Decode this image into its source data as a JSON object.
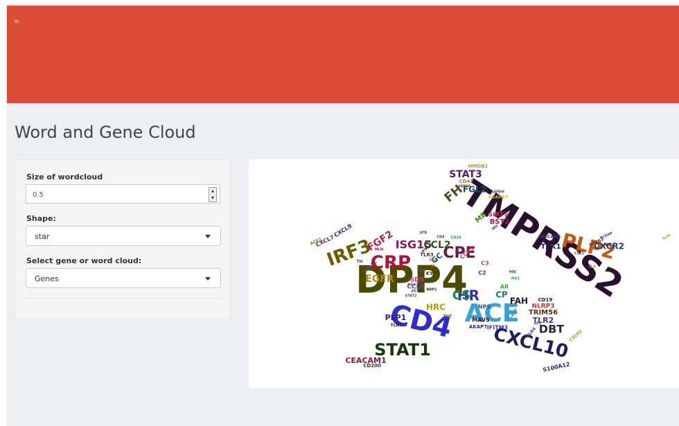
{
  "header": {
    "menu_icon": "hamburger-icon",
    "menu_glyph": "≡",
    "color": "#dd4b39"
  },
  "page": {
    "title": "Word and Gene Cloud",
    "background": "#ecf0f5"
  },
  "sidebar": {
    "size": {
      "label": "Size of wordcloud",
      "value": "0.5"
    },
    "shape": {
      "label": "Shape:",
      "selected": "star"
    },
    "cloud_type": {
      "label": "Select gene or word cloud:",
      "selected": "Genes"
    }
  },
  "wordcloud": {
    "words": [
      {
        "text": "DPP4",
        "color": "#4b4b00"
      },
      {
        "text": "TMPRSS2",
        "color": "#2b0f2e"
      },
      {
        "text": "CD4",
        "color": "#2d2dd2"
      },
      {
        "text": "ACE",
        "color": "#3aa0d6"
      },
      {
        "text": "CXCL10",
        "color": "#1f1f5a"
      },
      {
        "text": "PLP2",
        "color": "#c45a10"
      },
      {
        "text": "CRP",
        "color": "#b5123a"
      },
      {
        "text": "IRF3",
        "color": "#6b5a00"
      },
      {
        "text": "STAT1",
        "color": "#163a0a"
      },
      {
        "text": "CPE",
        "color": "#6a1a46"
      },
      {
        "text": "ISG15",
        "color": "#8b1a5c"
      },
      {
        "text": "HR",
        "color": "#2a2fb0"
      },
      {
        "text": "CS",
        "color": "#1f8a3b"
      },
      {
        "text": "FH",
        "color": "#5a4a20"
      },
      {
        "text": "STAT3",
        "color": "#4b1a78"
      },
      {
        "text": "CCL2",
        "color": "#2b5a1a"
      },
      {
        "text": "EGFR",
        "color": "#b58a10"
      },
      {
        "text": "FGL2",
        "color": "#1a4a5a"
      },
      {
        "text": "CXCR2",
        "color": "#1a3a7a"
      },
      {
        "text": "DBT",
        "color": "#2a2a2a"
      },
      {
        "text": "FGF2",
        "color": "#b02060"
      },
      {
        "text": "CEACAM1",
        "color": "#8a1a3a"
      },
      {
        "text": "PLP1",
        "color": "#3a1a6a"
      },
      {
        "text": "TLR2",
        "color": "#3a3a8a"
      },
      {
        "text": "TRIM56",
        "color": "#5a2a1a"
      },
      {
        "text": "CP",
        "color": "#1a7a6a"
      },
      {
        "text": "FAH",
        "color": "#1a1a1a"
      },
      {
        "text": "HRC",
        "color": "#b0a000"
      },
      {
        "text": "MB",
        "color": "#3a8a1a"
      },
      {
        "text": "TBK1",
        "color": "#1a1a3a"
      },
      {
        "text": "BST2",
        "color": "#a01a5a"
      },
      {
        "text": "SIRT1",
        "color": "#c0304a"
      },
      {
        "text": "NLRP3",
        "color": "#c03030"
      },
      {
        "text": "CCL5",
        "color": "#5a3aaa"
      },
      {
        "text": "SDS",
        "color": "#d0308a"
      },
      {
        "text": "GC",
        "color": "#1a4a7a"
      },
      {
        "text": "HMGB1",
        "color": "#d09020"
      },
      {
        "text": "AKAP7",
        "color": "#2a2a6a"
      },
      {
        "text": "IFITM3",
        "color": "#3a3a9a"
      },
      {
        "text": "MAVS",
        "color": "#1a1a1a"
      },
      {
        "text": "NPS",
        "color": "#2a5a8a"
      },
      {
        "text": "CD19",
        "color": "#1a1a1a"
      },
      {
        "text": "CD200",
        "color": "#5a1a3a"
      },
      {
        "text": "S100A12",
        "color": "#2a2a6a"
      },
      {
        "text": "CXCL9",
        "color": "#3a1a6a"
      },
      {
        "text": "CXCL7",
        "color": "#6a1a4a"
      },
      {
        "text": "CEACAM5",
        "color": "#3a3a7a"
      },
      {
        "text": "CD47",
        "color": "#a08030"
      },
      {
        "text": "ANPEP",
        "color": "#4a4a4a"
      },
      {
        "text": "ADAM17",
        "color": "#c0c030"
      },
      {
        "text": "GAPDH",
        "color": "#5a2a8a"
      },
      {
        "text": "C3",
        "color": "#c0309a"
      },
      {
        "text": "C2",
        "color": "#3a3a9a"
      },
      {
        "text": "TLR3",
        "color": "#3a3a3a"
      },
      {
        "text": "TLR7",
        "color": "#3a1a3a"
      },
      {
        "text": "CAT",
        "color": "#20a0c0"
      },
      {
        "text": "AR",
        "color": "#40a040"
      },
      {
        "text": "TNF",
        "color": "#6a6a20"
      },
      {
        "text": "IL6",
        "color": "#c08080"
      },
      {
        "text": "CCL3",
        "color": "#5a5a5a"
      },
      {
        "text": "CXCR5",
        "color": "#a0a020"
      },
      {
        "text": "STAT2",
        "color": "#4a4a4a"
      },
      {
        "text": "DDX1",
        "color": "#6a6a6a"
      },
      {
        "text": "TH",
        "color": "#6a3a3a"
      },
      {
        "text": "MLN",
        "color": "#8a1a3a"
      },
      {
        "text": "CIC",
        "color": "#3a3a3a"
      },
      {
        "text": "KY",
        "color": "#3a3a3a"
      },
      {
        "text": "SI",
        "color": "#8a5a2a"
      },
      {
        "text": "APC",
        "color": "#4a4a8a"
      },
      {
        "text": "TLR4",
        "color": "#3a3a9a"
      },
      {
        "text": "CCR5",
        "color": "#d03050"
      },
      {
        "text": "CD4",
        "color": "#5a2a6a"
      },
      {
        "text": "SOCS3",
        "color": "#3a3a3a"
      },
      {
        "text": "NCKAP",
        "color": "#3a3a8a"
      },
      {
        "text": "IL10",
        "color": "#a0a020"
      },
      {
        "text": "ACE2",
        "color": "#7a7a2a"
      },
      {
        "text": "CCL",
        "color": "#d03030"
      },
      {
        "text": "CD8",
        "color": "#5a5a5a"
      },
      {
        "text": "MK",
        "color": "#3a7a3a"
      },
      {
        "text": "ATR",
        "color": "#3a3a9a"
      },
      {
        "text": "CD14",
        "color": "#2a8a2a"
      },
      {
        "text": "MIC",
        "color": "#3a3a3a"
      },
      {
        "text": "MX1",
        "color": "#20a050"
      },
      {
        "text": "ACTB",
        "color": "#3a3a3a"
      },
      {
        "text": "CXCR2",
        "color": "#5a5a5a"
      },
      {
        "text": "NRP1",
        "color": "#2a2a2a"
      },
      {
        "text": "IFNB",
        "color": "#2a2a2a"
      }
    ]
  }
}
